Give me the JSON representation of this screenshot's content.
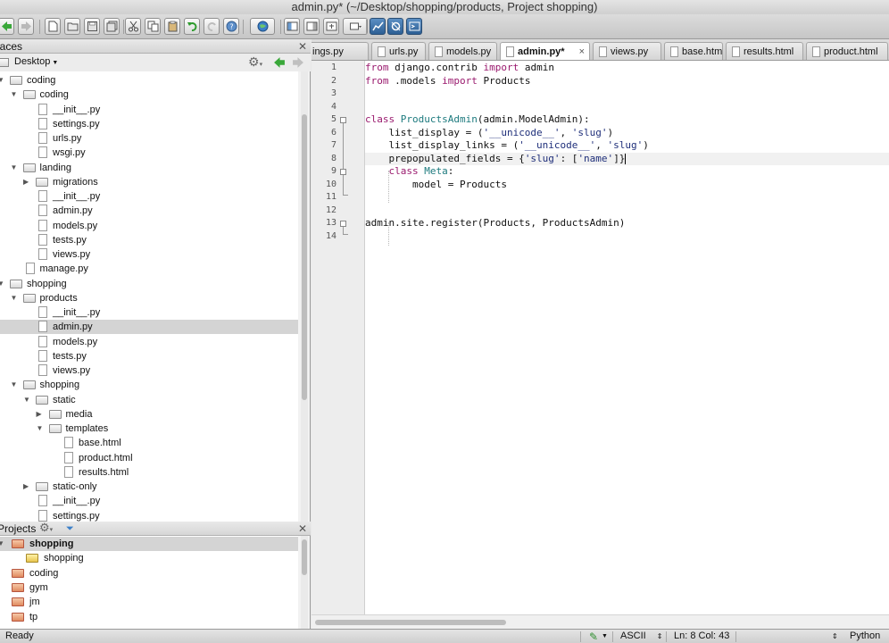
{
  "window": {
    "title": "admin.py* (~/Desktop/shopping/products, Project shopping)"
  },
  "places": {
    "title": "laces",
    "location": "Desktop",
    "tree": [
      {
        "label": "coding",
        "depth": 0,
        "kind": "folder",
        "state": "open"
      },
      {
        "label": "coding",
        "depth": 1,
        "kind": "folder",
        "state": "open"
      },
      {
        "label": "__init__.py",
        "depth": 2,
        "kind": "file"
      },
      {
        "label": "settings.py",
        "depth": 2,
        "kind": "file"
      },
      {
        "label": "urls.py",
        "depth": 2,
        "kind": "file"
      },
      {
        "label": "wsgi.py",
        "depth": 2,
        "kind": "file"
      },
      {
        "label": "landing",
        "depth": 1,
        "kind": "folder",
        "state": "open"
      },
      {
        "label": "migrations",
        "depth": 2,
        "kind": "folder",
        "state": "closed"
      },
      {
        "label": "__init__.py",
        "depth": 2,
        "kind": "file"
      },
      {
        "label": "admin.py",
        "depth": 2,
        "kind": "file"
      },
      {
        "label": "models.py",
        "depth": 2,
        "kind": "file"
      },
      {
        "label": "tests.py",
        "depth": 2,
        "kind": "file"
      },
      {
        "label": "views.py",
        "depth": 2,
        "kind": "file"
      },
      {
        "label": "manage.py",
        "depth": 1,
        "kind": "file"
      },
      {
        "label": "shopping",
        "depth": 0,
        "kind": "folder",
        "state": "open"
      },
      {
        "label": "products",
        "depth": 1,
        "kind": "folder",
        "state": "open"
      },
      {
        "label": "__init__.py",
        "depth": 2,
        "kind": "file"
      },
      {
        "label": "admin.py",
        "depth": 2,
        "kind": "file",
        "selected": true
      },
      {
        "label": "models.py",
        "depth": 2,
        "kind": "file"
      },
      {
        "label": "tests.py",
        "depth": 2,
        "kind": "file"
      },
      {
        "label": "views.py",
        "depth": 2,
        "kind": "file"
      },
      {
        "label": "shopping",
        "depth": 1,
        "kind": "folder",
        "state": "open"
      },
      {
        "label": "static",
        "depth": 2,
        "kind": "folder",
        "state": "open"
      },
      {
        "label": "media",
        "depth": 3,
        "kind": "folder",
        "state": "closed"
      },
      {
        "label": "templates",
        "depth": 3,
        "kind": "folder",
        "state": "open"
      },
      {
        "label": "base.html",
        "depth": 4,
        "kind": "file"
      },
      {
        "label": "product.html",
        "depth": 4,
        "kind": "file"
      },
      {
        "label": "results.html",
        "depth": 4,
        "kind": "file"
      },
      {
        "label": "static-only",
        "depth": 2,
        "kind": "folder",
        "state": "closed"
      },
      {
        "label": "__init__.py",
        "depth": 2,
        "kind": "file"
      },
      {
        "label": "settings.py",
        "depth": 2,
        "kind": "file"
      }
    ]
  },
  "projects": {
    "title": "Projects",
    "items": [
      {
        "label": "shopping",
        "depth": 0,
        "bold": true,
        "selected": true,
        "icon": "project-icon"
      },
      {
        "label": "shopping",
        "depth": 1,
        "icon": "folder-icon"
      },
      {
        "label": "coding",
        "depth": 0,
        "icon": "project-icon"
      },
      {
        "label": "gym",
        "depth": 0,
        "icon": "project-icon"
      },
      {
        "label": "jm",
        "depth": 0,
        "icon": "project-icon"
      },
      {
        "label": "tp",
        "depth": 0,
        "icon": "project-icon"
      }
    ]
  },
  "tabs": [
    {
      "label": "ings.py"
    },
    {
      "label": "urls.py"
    },
    {
      "label": "models.py"
    },
    {
      "label": "admin.py*",
      "active": true,
      "close": "×"
    },
    {
      "label": "views.py"
    },
    {
      "label": "base.html"
    },
    {
      "label": "results.html"
    },
    {
      "label": "product.html"
    }
  ],
  "code": [
    [
      [
        "kw",
        "from"
      ],
      [
        "t",
        " django.contrib "
      ],
      [
        "kw",
        "import"
      ],
      [
        "t",
        " admin"
      ]
    ],
    [
      [
        "kw",
        "from"
      ],
      [
        "t",
        " .models "
      ],
      [
        "kw",
        "import"
      ],
      [
        "t",
        " Products"
      ]
    ],
    [],
    [],
    [
      [
        "kw",
        "class"
      ],
      [
        "t",
        " "
      ],
      [
        "cn",
        "ProductsAdmin"
      ],
      [
        "t",
        "(admin.ModelAdmin):"
      ]
    ],
    [
      [
        "t",
        "    list_display = ("
      ],
      [
        "st",
        "'__unicode__'"
      ],
      [
        "t",
        ", "
      ],
      [
        "st",
        "'slug'"
      ],
      [
        "t",
        ")"
      ]
    ],
    [
      [
        "t",
        "    list_display_links = ("
      ],
      [
        "st",
        "'__unicode__'"
      ],
      [
        "t",
        ", "
      ],
      [
        "st",
        "'slug'"
      ],
      [
        "t",
        ")"
      ]
    ],
    [
      [
        "t",
        "    prepopulated_fields = {"
      ],
      [
        "st",
        "'slug'"
      ],
      [
        "t",
        ": ["
      ],
      [
        "st",
        "'name'"
      ],
      [
        "t",
        "]}"
      ]
    ],
    [
      [
        "t",
        "    "
      ],
      [
        "kw",
        "class"
      ],
      [
        "t",
        " "
      ],
      [
        "cn",
        "Meta"
      ],
      [
        "t",
        ":"
      ]
    ],
    [
      [
        "t",
        "        model = Products"
      ]
    ],
    [],
    [],
    [
      [
        "t",
        "admin.site.register(Products, ProductsAdmin)"
      ]
    ],
    []
  ],
  "status": {
    "left": "Ready",
    "encoding": "ASCII",
    "position": "Ln: 8 Col: 43",
    "language": "Python"
  }
}
